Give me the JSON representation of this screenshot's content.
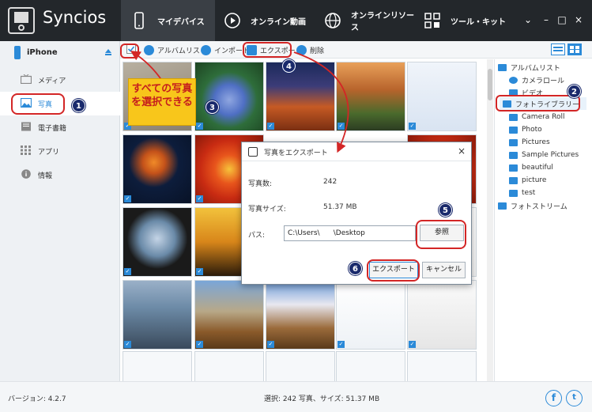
{
  "app": {
    "title": "Syncios",
    "window_controls": [
      "⌄",
      "–",
      "□",
      "×"
    ]
  },
  "nav": {
    "tabs": [
      {
        "label": "マイデバイス",
        "icon": "phone-icon",
        "active": true
      },
      {
        "label": "オンライン動画",
        "icon": "play-icon",
        "active": false
      },
      {
        "label": "オンラインリソース",
        "icon": "globe-icon",
        "active": false
      },
      {
        "label": "ツール・キット",
        "icon": "toolkit-icon",
        "active": false
      }
    ]
  },
  "sidebar": {
    "device": "iPhone",
    "items": [
      {
        "label": "メディア",
        "icon": "tv-icon",
        "active": false
      },
      {
        "label": "写真",
        "icon": "photo-icon",
        "active": true
      },
      {
        "label": "電子書籍",
        "icon": "book-icon",
        "active": false
      },
      {
        "label": "アプリ",
        "icon": "apps-grid-icon",
        "active": false
      },
      {
        "label": "情報",
        "icon": "info-icon",
        "active": false
      }
    ]
  },
  "toolbar": {
    "album_list": "アルバムリスト",
    "import": "インポート",
    "export": "エクスポート",
    "delete": "削除"
  },
  "albums": {
    "root": "アルバムリスト",
    "items": [
      "カメラロール",
      "ビデオ",
      "フォトライブラリー",
      "Camera Roll",
      "Photo",
      "Pictures",
      "Sample Pictures",
      "beautiful",
      "picture",
      "test"
    ],
    "selected": "フォトライブラリー",
    "stream": "フォトストリーム"
  },
  "dialog": {
    "title": "写真をエクスポート",
    "count_label": "写真数:",
    "count_value": "242",
    "size_label": "写真サイズ:",
    "size_value": "51.37 MB",
    "path_label": "パス:",
    "path_value": "C:\\Users\\      \\Desktop",
    "browse": "参照",
    "export": "エクスポート",
    "cancel": "キャンセル"
  },
  "status": {
    "version": "バージョン: 4.2.7",
    "summary": "選択: 242 写真、サイズ: 51.37 MB"
  },
  "annotations": {
    "callout": "すべての写真を選択できる",
    "badges": [
      "1",
      "2",
      "3",
      "4",
      "5",
      "6"
    ]
  },
  "colors": {
    "accent": "#2b8ad8",
    "topbar": "#23272b",
    "annotation_red": "#d32626",
    "callout_bg": "#f8c61b"
  }
}
